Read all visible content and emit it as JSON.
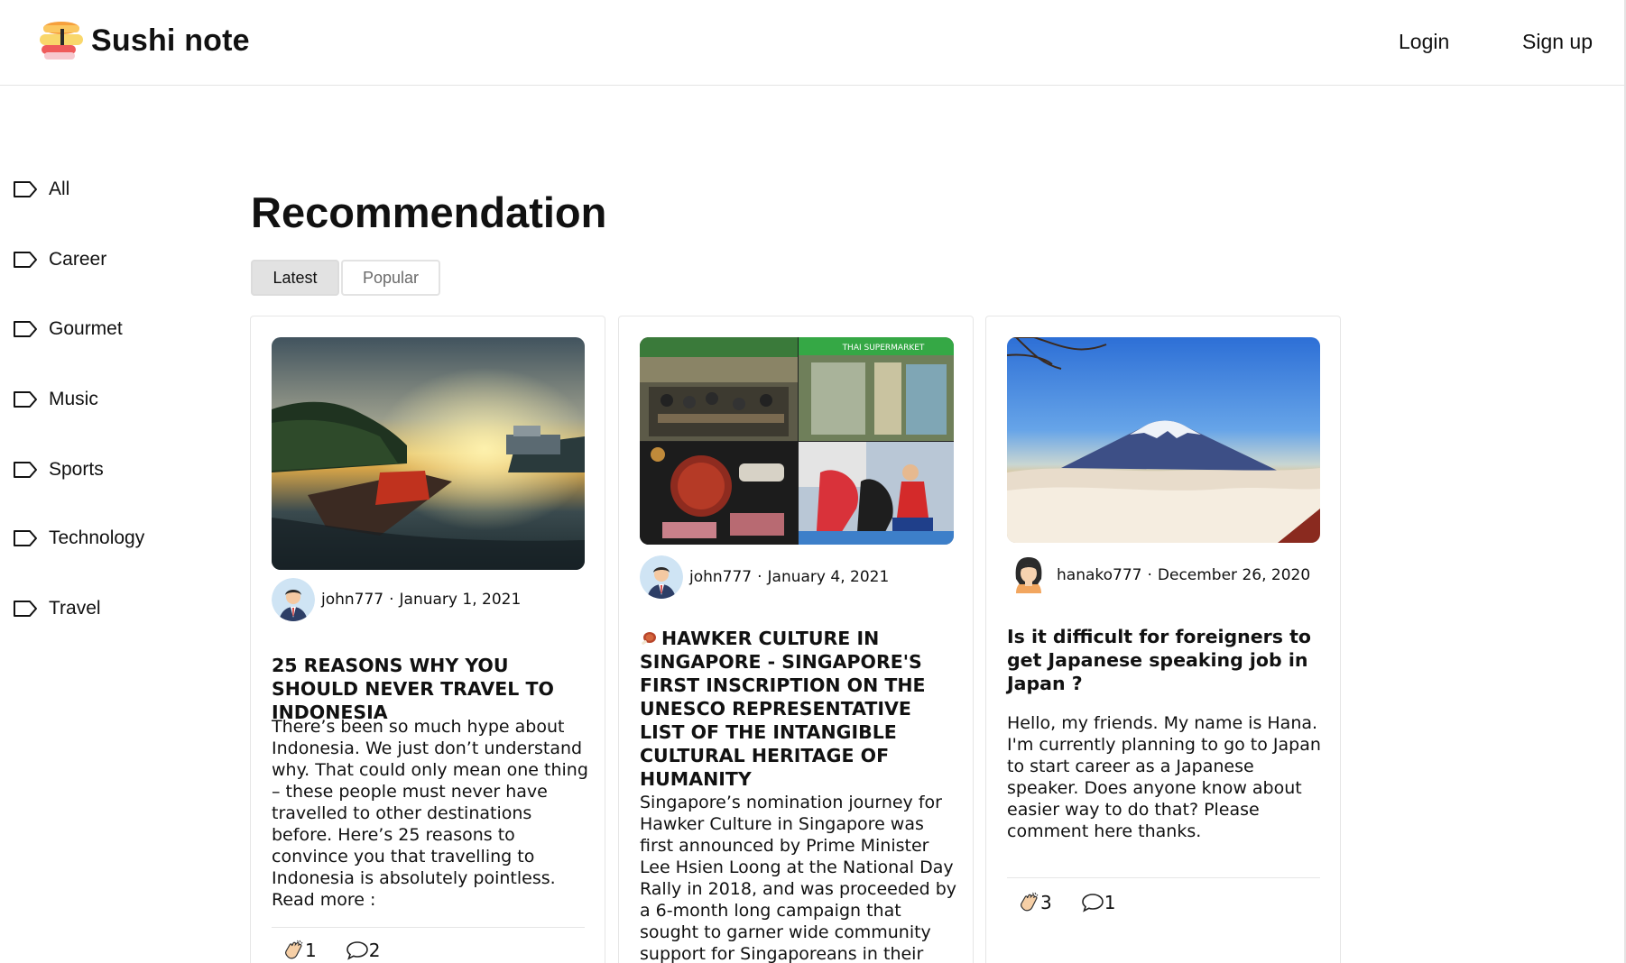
{
  "header": {
    "brand": "Sushi note",
    "login": "Login",
    "signup": "Sign up"
  },
  "sidebar": {
    "items": [
      {
        "label": "All",
        "icon": "tag-outline-icon"
      },
      {
        "label": "Career",
        "icon": "tag-outline-icon"
      },
      {
        "label": "Gourmet",
        "icon": "tag-outline-icon"
      },
      {
        "label": "Music",
        "icon": "tag-outline-icon"
      },
      {
        "label": "Sports",
        "icon": "tag-outline-icon"
      },
      {
        "label": "Technology",
        "icon": "tag-outline-icon"
      },
      {
        "label": "Travel",
        "icon": "tag-outline-icon"
      }
    ]
  },
  "main": {
    "title": "Recommendation",
    "tabs": [
      {
        "label": "Latest",
        "active": true
      },
      {
        "label": "Popular",
        "active": false
      }
    ]
  },
  "articles": [
    {
      "author": "john777",
      "date": "January 1, 2021",
      "title": "25 REASONS WHY YOU SHOULD NEVER TRAVEL TO INDONESIA",
      "excerpt": "There’s been so much hype about Indonesia. We just don’t understand why. That could only mean one thing – these people must never have travelled to other destinations before. Here’s 25 reasons to convince you that travelling to Indonesia is absolutely pointless. Read more :",
      "claps": "1",
      "comments": "2"
    },
    {
      "author": "john777",
      "date": "January 4, 2021",
      "title": "HAWKER CULTURE IN SINGAPORE - SINGAPORE'S FIRST INSCRIPTION ON THE UNESCO REPRESENTATIVE LIST OF THE INTANGIBLE CULTURAL HERITAGE OF HUMANITY",
      "excerpt": "Singapore’s nomination journey for Hawker Culture in Singapore was first announced by Prime Minister Lee Hsien Loong at the National Day Rally in 2018, and was proceeded by a 6-month long campaign that sought to garner wide community support for Singaporeans in their support for the",
      "image_text": "THAI SUPERMARKET",
      "claps": "",
      "comments": ""
    },
    {
      "author": "hanako777",
      "date": "December 26, 2020",
      "title": "Is it difficult for foreigners to get Japanese speaking job in Japan ?",
      "excerpt": "Hello, my friends. My name is Hana. I'm currently planning to go to Japan to start career as a Japanese speaker. Does anyone know about easier way to do that? Please comment here thanks.",
      "claps": "3",
      "comments": "1"
    }
  ],
  "colors": {
    "border": "#e6e6e6",
    "tab_active_bg": "#e2e2e2",
    "text": "#111111",
    "muted": "#6b6b6b"
  }
}
